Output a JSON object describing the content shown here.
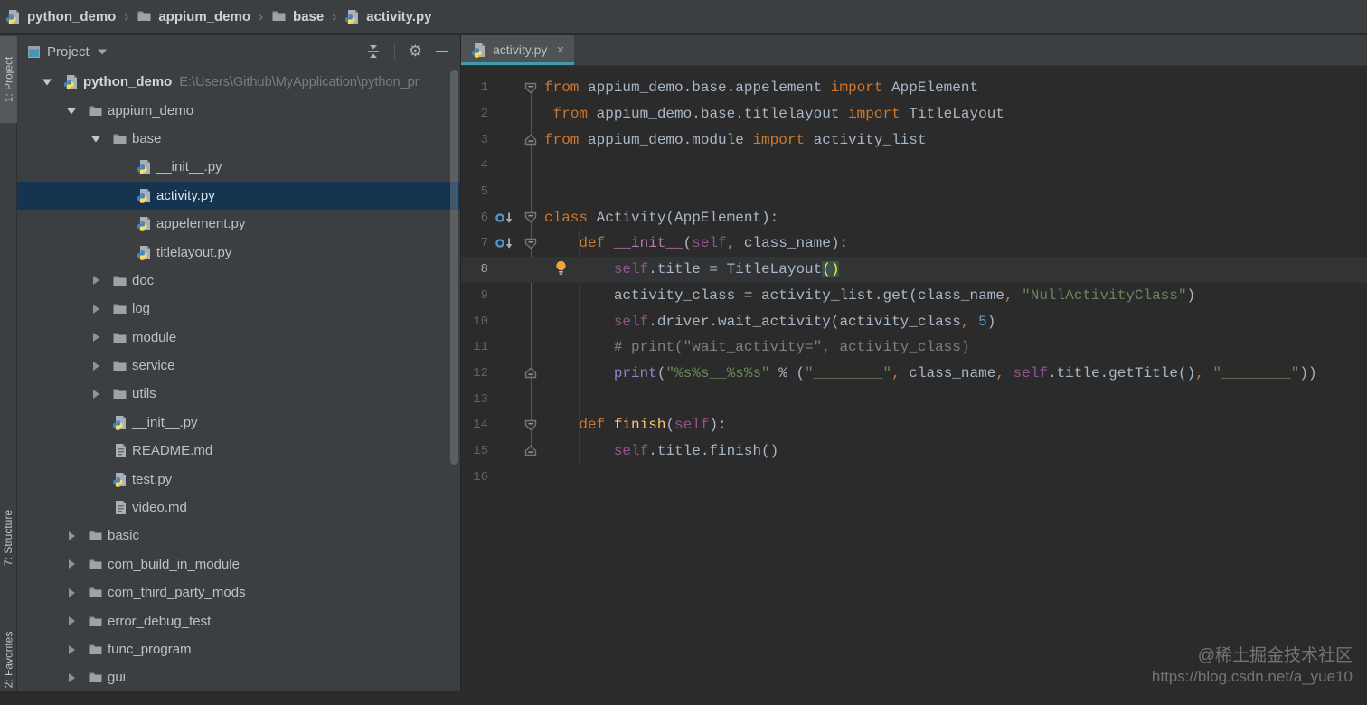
{
  "breadcrumb": {
    "items": [
      {
        "label": "python_demo",
        "icon": "python-file"
      },
      {
        "label": "appium_demo",
        "icon": "folder"
      },
      {
        "label": "base",
        "icon": "folder"
      },
      {
        "label": "activity.py",
        "icon": "python-file"
      }
    ],
    "separator": "›"
  },
  "stripe_buttons": {
    "project": "1: Project",
    "structure": "7: Structure",
    "favorites": "2: Favorites"
  },
  "project_panel": {
    "title": "Project",
    "tree": [
      {
        "label": "python_demo",
        "icon": "python-file",
        "level": 0,
        "arrow": "expanded",
        "bold": true,
        "suffix": "E:\\Users\\Github\\MyApplication\\python_pr"
      },
      {
        "label": "appium_demo",
        "icon": "folder",
        "level": 1,
        "arrow": "expanded"
      },
      {
        "label": "base",
        "icon": "folder",
        "level": 2,
        "arrow": "expanded"
      },
      {
        "label": "__init__.py",
        "icon": "python-file",
        "level": 3
      },
      {
        "label": "activity.py",
        "icon": "python-file",
        "level": 3,
        "selected": true
      },
      {
        "label": "appelement.py",
        "icon": "python-file",
        "level": 3
      },
      {
        "label": "titlelayout.py",
        "icon": "python-file",
        "level": 3
      },
      {
        "label": "doc",
        "icon": "folder",
        "level": 2,
        "arrow": "collapsed"
      },
      {
        "label": "log",
        "icon": "folder",
        "level": 2,
        "arrow": "collapsed"
      },
      {
        "label": "module",
        "icon": "folder",
        "level": 2,
        "arrow": "collapsed"
      },
      {
        "label": "service",
        "icon": "folder",
        "level": 2,
        "arrow": "collapsed"
      },
      {
        "label": "utils",
        "icon": "folder",
        "level": 2,
        "arrow": "collapsed"
      },
      {
        "label": "__init__.py",
        "icon": "python-file",
        "level": 2
      },
      {
        "label": "README.md",
        "icon": "text-file",
        "level": 2
      },
      {
        "label": "test.py",
        "icon": "python-file",
        "level": 2
      },
      {
        "label": "video.md",
        "icon": "text-file",
        "level": 2
      },
      {
        "label": "basic",
        "icon": "folder",
        "level": 1,
        "arrow": "collapsed"
      },
      {
        "label": "com_build_in_module",
        "icon": "folder",
        "level": 1,
        "arrow": "collapsed"
      },
      {
        "label": "com_third_party_mods",
        "icon": "folder",
        "level": 1,
        "arrow": "collapsed"
      },
      {
        "label": "error_debug_test",
        "icon": "folder",
        "level": 1,
        "arrow": "collapsed"
      },
      {
        "label": "func_program",
        "icon": "folder",
        "level": 1,
        "arrow": "collapsed"
      },
      {
        "label": "gui",
        "icon": "folder",
        "level": 1,
        "arrow": "collapsed"
      }
    ]
  },
  "editor": {
    "tab": {
      "label": "activity.py",
      "close": "×"
    },
    "lines": [
      {
        "n": 1,
        "fold": "down",
        "tokens": [
          [
            "from",
            "kw"
          ],
          [
            " appium_demo.base.appelement ",
            "id"
          ],
          [
            "import",
            "kw"
          ],
          [
            " AppElement",
            "id"
          ]
        ]
      },
      {
        "n": 2,
        "tokens": [
          [
            " ",
            "id"
          ],
          [
            "from",
            "kw"
          ],
          [
            " appium_demo.base.titlelayout ",
            "id"
          ],
          [
            "import",
            "kw"
          ],
          [
            " TitleLayout",
            "id"
          ]
        ]
      },
      {
        "n": 3,
        "fold": "up",
        "tokens": [
          [
            "from",
            "kw"
          ],
          [
            " appium_demo.module ",
            "id"
          ],
          [
            "import",
            "kw"
          ],
          [
            " activity_list",
            "id"
          ]
        ]
      },
      {
        "n": 4,
        "tokens": []
      },
      {
        "n": 5,
        "tokens": []
      },
      {
        "n": 6,
        "fold": "down",
        "gutter": "override",
        "tokens": [
          [
            "class",
            "kw"
          ],
          [
            " Activity(AppElement):",
            "id"
          ]
        ]
      },
      {
        "n": 7,
        "fold": "down",
        "gutter": "override",
        "tokens": [
          [
            "    ",
            "id"
          ],
          [
            "def",
            "kw"
          ],
          [
            " ",
            "id"
          ],
          [
            "__init__",
            "magic"
          ],
          [
            "(",
            "id"
          ],
          [
            "self",
            "self"
          ],
          [
            ",",
            "kw"
          ],
          [
            " class_name):",
            "id"
          ]
        ]
      },
      {
        "n": 8,
        "bulb": true,
        "current": true,
        "tokens": [
          [
            "        ",
            "id"
          ],
          [
            "self",
            "self"
          ],
          [
            ".title = TitleLayout",
            "id"
          ],
          [
            "()",
            "brace"
          ]
        ]
      },
      {
        "n": 9,
        "tokens": [
          [
            "        activity_class = activity_list.get(class_name",
            "id"
          ],
          [
            ",",
            "kw"
          ],
          [
            " ",
            "id"
          ],
          [
            "\"NullActivityClass\"",
            "str"
          ],
          [
            ")",
            "id"
          ]
        ]
      },
      {
        "n": 10,
        "tokens": [
          [
            "        ",
            "id"
          ],
          [
            "self",
            "self"
          ],
          [
            ".driver.wait_activity(activity_class",
            "id"
          ],
          [
            ",",
            "kw"
          ],
          [
            " ",
            "id"
          ],
          [
            "5",
            "num"
          ],
          [
            ")",
            "id"
          ]
        ]
      },
      {
        "n": 11,
        "tokens": [
          [
            "        # print(\"wait_activity=\", activity_class)",
            "comment"
          ]
        ]
      },
      {
        "n": 12,
        "fold": "up",
        "tokens": [
          [
            "        ",
            "id"
          ],
          [
            "print",
            "builtin"
          ],
          [
            "(",
            "id"
          ],
          [
            "\"%s%s__%s%s\"",
            "str"
          ],
          [
            " % (",
            "id"
          ],
          [
            "\"________\"",
            "str"
          ],
          [
            ",",
            "kw"
          ],
          [
            " class_name",
            "id"
          ],
          [
            ",",
            "kw"
          ],
          [
            " ",
            "id"
          ],
          [
            "self",
            "self"
          ],
          [
            ".title.getTitle()",
            "id"
          ],
          [
            ",",
            "kw"
          ],
          [
            " ",
            "id"
          ],
          [
            "\"________\"",
            "str"
          ],
          [
            "))",
            "id"
          ]
        ]
      },
      {
        "n": 13,
        "tokens": []
      },
      {
        "n": 14,
        "fold": "down",
        "tokens": [
          [
            "    ",
            "id"
          ],
          [
            "def",
            "kw"
          ],
          [
            " ",
            "id"
          ],
          [
            "finish",
            "fn"
          ],
          [
            "(",
            "id"
          ],
          [
            "self",
            "self"
          ],
          [
            "):",
            "id"
          ]
        ]
      },
      {
        "n": 15,
        "fold": "up",
        "tokens": [
          [
            "        ",
            "id"
          ],
          [
            "self",
            "self"
          ],
          [
            ".title.finish()",
            "id"
          ]
        ]
      },
      {
        "n": 16,
        "tokens": []
      }
    ]
  },
  "watermark": {
    "line1": "@稀土掘金技术社区",
    "line2": "https://blog.csdn.net/a_yue10"
  },
  "colors": {
    "editor_bg": "#2b2b2b",
    "panel_bg": "#3c3f41",
    "selection": "#153450",
    "tab_underline": "#3d9cad",
    "current_line": "#323334",
    "kw": "#cc7832",
    "id": "#a9b7c6",
    "str": "#6a8759",
    "num": "#6897bb",
    "comment": "#808080",
    "self": "#94558d",
    "magic": "#b779b0",
    "fn": "#ffc66b",
    "builtin": "#8888c6",
    "brace_bg": "#3b514d",
    "brace_text": "#ffef28",
    "lineno": "#606366"
  }
}
